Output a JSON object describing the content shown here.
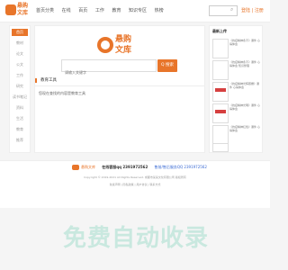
{
  "brand": {
    "name": "悬购文库",
    "line1": "悬购",
    "line2": "文库",
    "accent": "#e8752a"
  },
  "nav": [
    "首页分类",
    "在线",
    "百页",
    "工作",
    "教育",
    "知识专区",
    "热榜"
  ],
  "top_search": {
    "placeholder": ""
  },
  "login": "登陆 | 注册",
  "sidebar": [
    "首页",
    "教材",
    "论文",
    "公文",
    "工作",
    "研究",
    "读书笔记",
    "资料",
    "生活",
    "教育",
    "推荐"
  ],
  "main": {
    "search_placeholder": "请输入关键字",
    "search_button": "Q 搜索",
    "section_title": "教育工具",
    "section_text": "您现在查找的内容是教育工具"
  },
  "right": {
    "title": "最新上传",
    "items": [
      "《抗疫精神永不》课件 心得体会",
      "《抗疫精神永不》课件 心得体会 知识整理",
      "《抗疫精神光辉照耀》课件 心得体会",
      "《抗疫精神光明》课件 心得体会",
      "《抗疫精神红色》课件 心得体会",
      "《抗疫精神光辉》课件 心得体会"
    ]
  },
  "footer": {
    "brand": "悬购文库",
    "label1": "在线客服qq 2391972562",
    "label2": "售前/售后服务QQ 2391972562",
    "copyright": "Copyright © 2019-2021 All Rights Reserved. 成都市某某文化有限公司 版权所有",
    "icp": "免责声明 | 隐私政策 | 用户协议 | 联系方式"
  },
  "watermark": "免费自动收录"
}
